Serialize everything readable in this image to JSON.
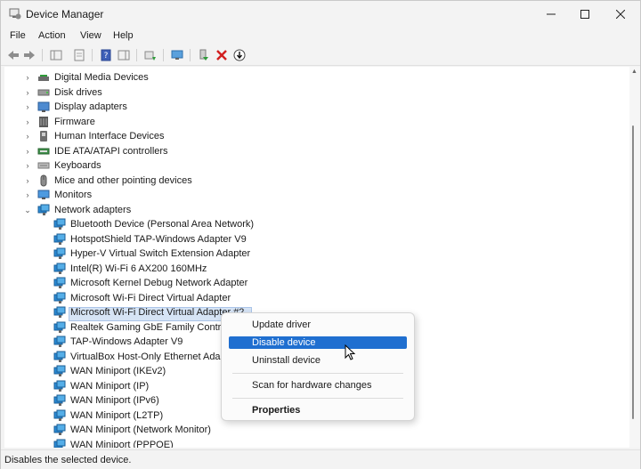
{
  "window": {
    "title": "Device Manager"
  },
  "menubar": [
    "File",
    "Action",
    "View",
    "Help"
  ],
  "tree": {
    "categories": [
      {
        "label": "Digital Media Devices",
        "icon": "media-device-icon",
        "expanded": false
      },
      {
        "label": "Disk drives",
        "icon": "disk-drive-icon",
        "expanded": false
      },
      {
        "label": "Display adapters",
        "icon": "display-adapter-icon",
        "expanded": false
      },
      {
        "label": "Firmware",
        "icon": "firmware-icon",
        "expanded": false
      },
      {
        "label": "Human Interface Devices",
        "icon": "hid-icon",
        "expanded": false
      },
      {
        "label": "IDE ATA/ATAPI controllers",
        "icon": "ide-controller-icon",
        "expanded": false
      },
      {
        "label": "Keyboards",
        "icon": "keyboard-icon",
        "expanded": false
      },
      {
        "label": "Mice and other pointing devices",
        "icon": "mouse-icon",
        "expanded": false
      },
      {
        "label": "Monitors",
        "icon": "monitor-icon",
        "expanded": false
      },
      {
        "label": "Network adapters",
        "icon": "network-adapter-icon",
        "expanded": true
      }
    ],
    "network_adapters": [
      "Bluetooth Device (Personal Area Network)",
      "HotspotShield TAP-Windows Adapter V9",
      "Hyper-V Virtual Switch Extension Adapter",
      "Intel(R) Wi-Fi 6 AX200 160MHz",
      "Microsoft Kernel Debug Network Adapter",
      "Microsoft Wi-Fi Direct Virtual Adapter",
      "Microsoft Wi-Fi Direct Virtual Adapter #2",
      "Realtek Gaming GbE Family Controller",
      "TAP-Windows Adapter V9",
      "VirtualBox Host-Only Ethernet Adapter",
      "WAN Miniport (IKEv2)",
      "WAN Miniport (IP)",
      "WAN Miniport (IPv6)",
      "WAN Miniport (L2TP)",
      "WAN Miniport (Network Monitor)",
      "WAN Miniport (PPPOE)"
    ],
    "selected_index": 6
  },
  "context_menu": {
    "items": [
      "Update driver",
      "Disable device",
      "Uninstall device",
      "Scan for hardware changes",
      "Properties"
    ],
    "highlighted": "Disable device"
  },
  "statusbar": {
    "text": "Disables the selected device."
  },
  "colors": {
    "highlight": "#1f6fd0",
    "selection": "#d6e4f5",
    "network_icon": "#2a8bd6"
  }
}
